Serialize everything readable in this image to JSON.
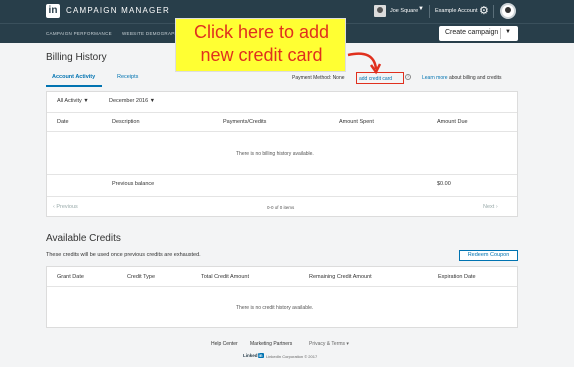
{
  "app": {
    "logo": "in",
    "title": "CAMPAIGN MANAGER"
  },
  "account": {
    "user": "Joe Square",
    "company": "Example Account"
  },
  "nav": {
    "crumbs": [
      "CAMPAIGN PERFORMANCE",
      "WEBSITE DEMOGRAPHICS"
    ],
    "create_label": "Create campaign"
  },
  "billing": {
    "title": "Billing History",
    "tabs": [
      "Account Activity",
      "Receipts"
    ],
    "payment_method_label": "Payment Method: None",
    "add_cc_label": "add credit card",
    "learn_more": "Learn more",
    "learn_rest": " about billing and credits",
    "filters": [
      "All Activity",
      "December 2016"
    ],
    "columns": [
      "Date",
      "Description",
      "Payments/Credits",
      "Amount Spent",
      "Amount Due"
    ],
    "empty_text": "There is no billing history available.",
    "previous_balance_label": "Previous balance",
    "previous_balance_amount": "$0.00",
    "pager": {
      "prev": "Previous",
      "status": "0-0 of 0 items",
      "next": "Next"
    }
  },
  "credits": {
    "title": "Available Credits",
    "subtitle": "These credits will be used once previous credits are exhausted.",
    "redeem_label": "Redeem Coupon",
    "columns": [
      "Grant Date",
      "Credit Type",
      "Total Credit Amount",
      "Remaining Credit Amount",
      "Expiration Date"
    ],
    "empty_text": "There is no credit history available."
  },
  "footer": {
    "links": [
      "Help Center",
      "Marketing Partners",
      "Privacy & Terms"
    ],
    "brand": "Linked",
    "brand_in": "in",
    "copyright": "LinkedIn Corporation © 2017"
  },
  "annotation": {
    "line1": "Click here to add",
    "line2": "new credit card"
  },
  "colors": {
    "header": "#283e4a",
    "link": "#0073b1",
    "callout_bg": "#ffff33",
    "callout_text": "#e0301e"
  }
}
